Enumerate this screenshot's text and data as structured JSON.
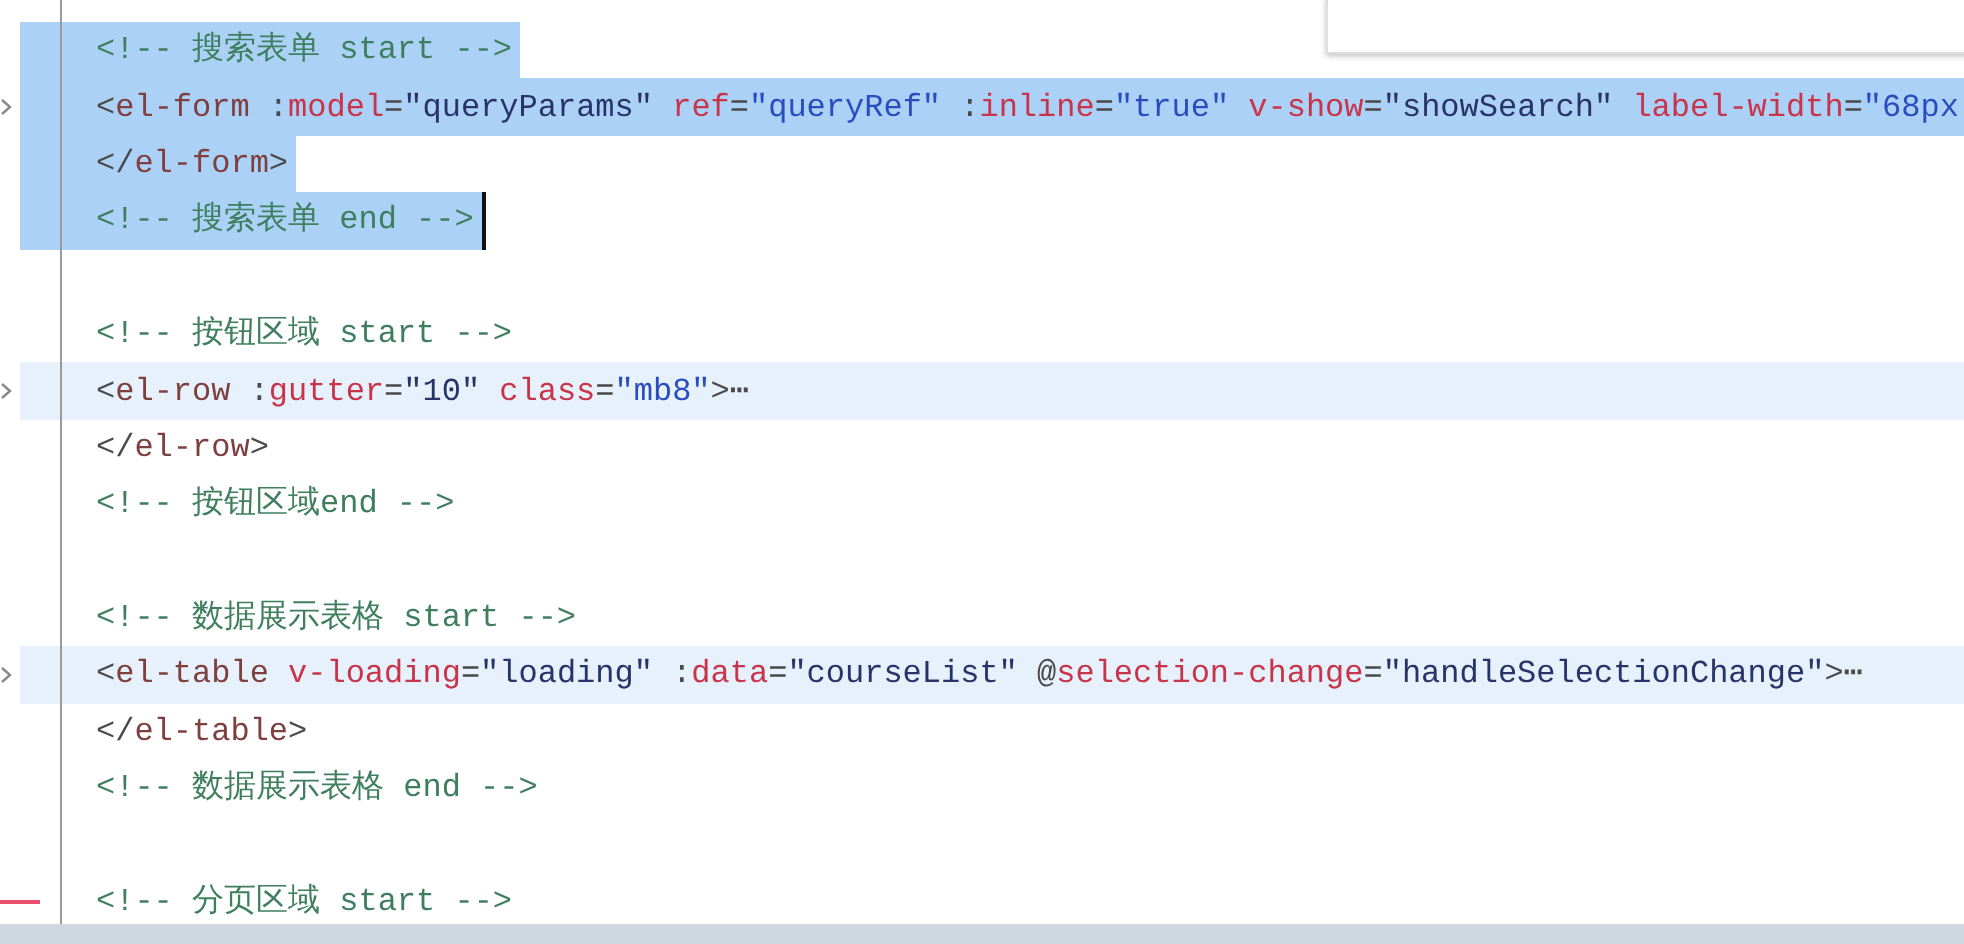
{
  "editor": {
    "lines": [
      {
        "kind": "code",
        "selected": true,
        "current": false,
        "folded": false,
        "caret": false,
        "modified": false,
        "tokens": [
          {
            "kind": "c",
            "text": "<!-- 搜索表单 start -->"
          }
        ]
      },
      {
        "kind": "code",
        "selected": true,
        "current": false,
        "folded": true,
        "caret": false,
        "modified": false,
        "tokens": [
          {
            "kind": "p",
            "text": "<"
          },
          {
            "kind": "t",
            "text": "el-form"
          },
          {
            "kind": "p",
            "text": " :"
          },
          {
            "kind": "a",
            "text": "model"
          },
          {
            "kind": "p",
            "text": "="
          },
          {
            "kind": "s",
            "text": "\"queryParams\""
          },
          {
            "kind": "a",
            "text": " ref"
          },
          {
            "kind": "p",
            "text": "="
          },
          {
            "kind": "v",
            "text": "\"queryRef\""
          },
          {
            "kind": "p",
            "text": " :"
          },
          {
            "kind": "a",
            "text": "inline"
          },
          {
            "kind": "p",
            "text": "="
          },
          {
            "kind": "v",
            "text": "\"true\""
          },
          {
            "kind": "a",
            "text": " v-show"
          },
          {
            "kind": "p",
            "text": "="
          },
          {
            "kind": "s",
            "text": "\"showSearch\""
          },
          {
            "kind": "a",
            "text": " label-width"
          },
          {
            "kind": "p",
            "text": "="
          },
          {
            "kind": "v",
            "text": "\"68px"
          }
        ]
      },
      {
        "kind": "code",
        "selected": true,
        "current": false,
        "folded": false,
        "caret": false,
        "modified": false,
        "tokens": [
          {
            "kind": "p",
            "text": "</"
          },
          {
            "kind": "t",
            "text": "el-form"
          },
          {
            "kind": "p",
            "text": ">"
          }
        ]
      },
      {
        "kind": "code",
        "selected": true,
        "current": false,
        "folded": false,
        "caret": true,
        "modified": false,
        "tokens": [
          {
            "kind": "c",
            "text": "<!-- 搜索表单 end -->"
          }
        ]
      },
      {
        "kind": "blank"
      },
      {
        "kind": "code",
        "selected": false,
        "current": false,
        "folded": false,
        "caret": false,
        "modified": false,
        "tokens": [
          {
            "kind": "c",
            "text": "<!-- 按钮区域 start -->"
          }
        ]
      },
      {
        "kind": "code",
        "selected": false,
        "current": true,
        "folded": true,
        "caret": false,
        "modified": false,
        "tokens": [
          {
            "kind": "p",
            "text": "<"
          },
          {
            "kind": "t",
            "text": "el-row"
          },
          {
            "kind": "p",
            "text": " :"
          },
          {
            "kind": "a",
            "text": "gutter"
          },
          {
            "kind": "p",
            "text": "="
          },
          {
            "kind": "s",
            "text": "\"10\""
          },
          {
            "kind": "a",
            "text": " class"
          },
          {
            "kind": "p",
            "text": "="
          },
          {
            "kind": "v",
            "text": "\"mb8\""
          },
          {
            "kind": "p",
            "text": ">⋯"
          }
        ]
      },
      {
        "kind": "code",
        "selected": false,
        "current": false,
        "folded": false,
        "caret": false,
        "modified": false,
        "tokens": [
          {
            "kind": "p",
            "text": "</"
          },
          {
            "kind": "t",
            "text": "el-row"
          },
          {
            "kind": "p",
            "text": ">"
          }
        ]
      },
      {
        "kind": "code",
        "selected": false,
        "current": false,
        "folded": false,
        "caret": false,
        "modified": false,
        "tokens": [
          {
            "kind": "c",
            "text": "<!-- 按钮区域end -->"
          }
        ]
      },
      {
        "kind": "blank"
      },
      {
        "kind": "code",
        "selected": false,
        "current": false,
        "folded": false,
        "caret": false,
        "modified": false,
        "tokens": [
          {
            "kind": "c",
            "text": "<!-- 数据展示表格 start -->"
          }
        ]
      },
      {
        "kind": "code",
        "selected": false,
        "current": true,
        "folded": true,
        "caret": false,
        "modified": false,
        "tokens": [
          {
            "kind": "p",
            "text": "<"
          },
          {
            "kind": "t",
            "text": "el-table"
          },
          {
            "kind": "a",
            "text": " v-loading"
          },
          {
            "kind": "p",
            "text": "="
          },
          {
            "kind": "s",
            "text": "\"loading\""
          },
          {
            "kind": "p",
            "text": " :"
          },
          {
            "kind": "a",
            "text": "data"
          },
          {
            "kind": "p",
            "text": "="
          },
          {
            "kind": "s",
            "text": "\"courseList\""
          },
          {
            "kind": "p",
            "text": " @"
          },
          {
            "kind": "a",
            "text": "selection-change"
          },
          {
            "kind": "p",
            "text": "="
          },
          {
            "kind": "s",
            "text": "\"handleSelectionChange\""
          },
          {
            "kind": "p",
            "text": ">⋯"
          }
        ]
      },
      {
        "kind": "code",
        "selected": false,
        "current": false,
        "folded": false,
        "caret": false,
        "modified": false,
        "tokens": [
          {
            "kind": "p",
            "text": "</"
          },
          {
            "kind": "t",
            "text": "el-table"
          },
          {
            "kind": "p",
            "text": ">"
          }
        ]
      },
      {
        "kind": "code",
        "selected": false,
        "current": false,
        "folded": false,
        "caret": false,
        "modified": false,
        "tokens": [
          {
            "kind": "c",
            "text": "<!-- 数据展示表格 end -->"
          }
        ]
      },
      {
        "kind": "blank"
      },
      {
        "kind": "code",
        "selected": false,
        "current": false,
        "folded": false,
        "caret": false,
        "modified": true,
        "tokens": [
          {
            "kind": "c",
            "text": "<!-- 分页区域 start -->"
          }
        ]
      }
    ]
  }
}
